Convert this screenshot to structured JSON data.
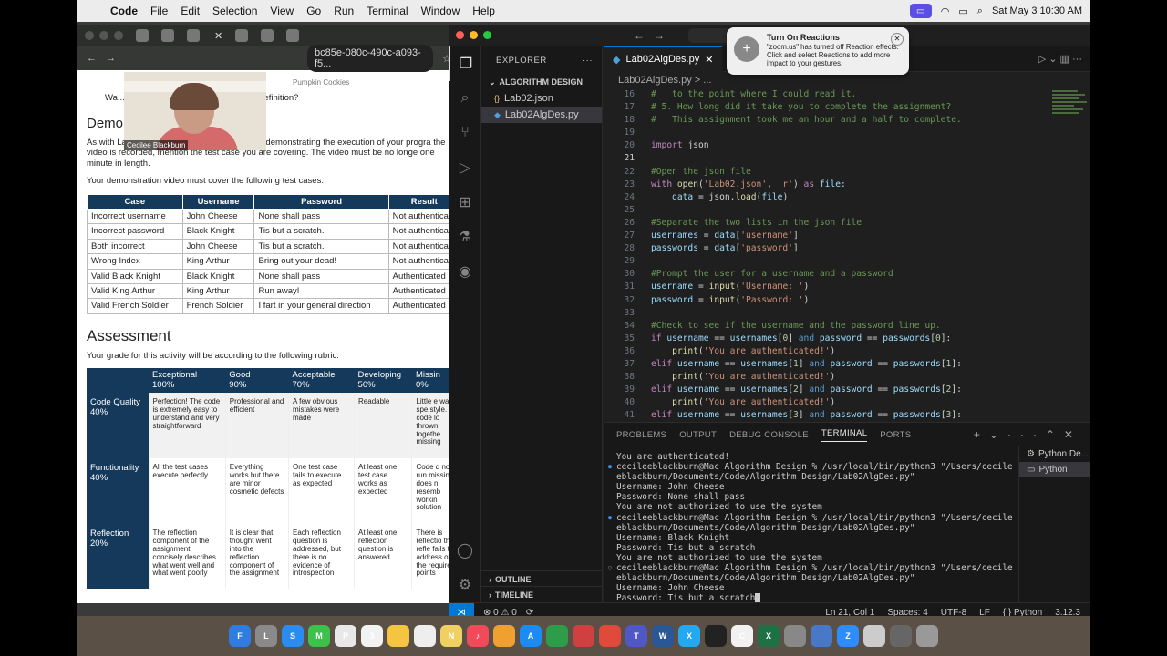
{
  "menubar": {
    "app": "Code",
    "items": [
      "File",
      "Edit",
      "Selection",
      "View",
      "Go",
      "Run",
      "Terminal",
      "Window",
      "Help"
    ],
    "datetime": "Sat May 3  10:30 AM"
  },
  "browser": {
    "address": "bc85e-080c-490c-a093-f5...",
    "tab_partial": "Pumpkin Cookies",
    "doc_line_partial": "Wa...ructions or any part of the problem definition?",
    "demo_heading": "Demon",
    "demo_para": "As with Lab 01 last week, record a short video demonstrating the execution of your progra the video is recorded, mention the test case you are covering. The video must be no longe one minute in length.",
    "demo_para2": "Your demonstration video must cover the following test cases:",
    "test_headers": [
      "Case",
      "Username",
      "Password",
      "Result"
    ],
    "test_rows": [
      [
        "Incorrect username",
        "John Cheese",
        "None shall pass",
        "Not authentica"
      ],
      [
        "Incorrect password",
        "Black Knight",
        "Tis but a scratch.",
        "Not authentica"
      ],
      [
        "Both incorrect",
        "John Cheese",
        "Tis but a scratch.",
        "Not authentica"
      ],
      [
        "Wrong Index",
        "King Arthur",
        "Bring out your dead!",
        "Not authentica"
      ],
      [
        "Valid Black Knight",
        "Black Knight",
        "None shall pass",
        "Authenticated"
      ],
      [
        "Valid King Arthur",
        "King Arthur",
        "Run away!",
        "Authenticated"
      ],
      [
        "Valid French Soldier",
        "French Soldier",
        "I fart in your general direction",
        "Authenticated"
      ]
    ],
    "assessment_heading": "Assessment",
    "assessment_para": "Your grade for this activity will be according to the following rubric:",
    "rubric_headers": [
      "",
      "Exceptional\n100%",
      "Good\n90%",
      "Acceptable\n70%",
      "Developing\n50%",
      "Missin\n0%"
    ],
    "rubric_rows": [
      [
        "Code Quality 40%",
        "Perfection! The code is extremely easy to understand and very straightforward",
        "Professional and efficient",
        "A few obvious mistakes were made",
        "Readable",
        "Little e was spe style. T code lo thrown togethe missing"
      ],
      [
        "Functionality 40%",
        "All the test cases execute perfectly",
        "Everything works but there are minor cosmetic defects",
        "One test case fails to execute as expected",
        "At least one test case works as expected",
        "Code d not run missing does n resemb workin solution"
      ],
      [
        "Reflection 20%",
        "The reflection component of the assignment concisely describes what went well and what went poorly",
        "It is clear that thought went into the reflection component of the assignment",
        "Each reflection question is addressed, but there is no evidence of introspection",
        "At least one reflection question is answered",
        "There is reflectio the refle fails to address of the required points"
      ]
    ]
  },
  "video": {
    "name": "Cecilee Blackburn"
  },
  "vscode": {
    "explorer_label": "EXPLORER",
    "folder": "ALGORITHM DESIGN",
    "files": [
      "Lab02.json",
      "Lab02AlgDes.py"
    ],
    "tab": "Lab02AlgDes.py",
    "crumb": "Lab02AlgDes.py > ...",
    "outline": "OUTLINE",
    "timeline": "TIMELINE",
    "code": [
      {
        "n": "16",
        "html": "<span class=\"cm\">#   to the point where I could read it.</span>"
      },
      {
        "n": "17",
        "html": "<span class=\"cm\"># 5. How long did it take you to complete the assignment?</span>"
      },
      {
        "n": "18",
        "html": "<span class=\"cm\">#   This assignment took me an hour and a half to complete.</span>"
      },
      {
        "n": "19",
        "html": ""
      },
      {
        "n": "20",
        "html": "<span class=\"kw\">import</span> <span class=\"tx\">json</span>"
      },
      {
        "n": "21",
        "html": ""
      },
      {
        "n": "22",
        "html": "<span class=\"cm\">#Open the json file</span>"
      },
      {
        "n": "23",
        "html": "<span class=\"kw\">with</span> <span class=\"fn\">open</span><span class=\"tx\">(</span><span class=\"st\">'Lab02.json'</span><span class=\"tx\">, </span><span class=\"st\">'r'</span><span class=\"tx\">) </span><span class=\"kw\">as</span> <span class=\"va\">file</span><span class=\"tx\">:</span>"
      },
      {
        "n": "24",
        "html": "    <span class=\"va\">data</span> <span class=\"tx\">= json.</span><span class=\"fn\">load</span><span class=\"tx\">(</span><span class=\"va\">file</span><span class=\"tx\">)</span>"
      },
      {
        "n": "25",
        "html": ""
      },
      {
        "n": "26",
        "html": "<span class=\"cm\">#Separate the two lists in the json file</span>"
      },
      {
        "n": "27",
        "html": "<span class=\"va\">usernames</span> <span class=\"tx\">= </span><span class=\"va\">data</span><span class=\"tx\">[</span><span class=\"st\">'username'</span><span class=\"tx\">]</span>"
      },
      {
        "n": "28",
        "html": "<span class=\"va\">passwords</span> <span class=\"tx\">= </span><span class=\"va\">data</span><span class=\"tx\">[</span><span class=\"st\">'password'</span><span class=\"tx\">]</span>"
      },
      {
        "n": "29",
        "html": ""
      },
      {
        "n": "30",
        "html": "<span class=\"cm\">#Prompt the user for a username and a password</span>"
      },
      {
        "n": "31",
        "html": "<span class=\"va\">username</span> <span class=\"tx\">= </span><span class=\"fn\">input</span><span class=\"tx\">(</span><span class=\"st\">'Username: '</span><span class=\"tx\">)</span>"
      },
      {
        "n": "32",
        "html": "<span class=\"va\">password</span> <span class=\"tx\">= </span><span class=\"fn\">input</span><span class=\"tx\">(</span><span class=\"st\">'Password: '</span><span class=\"tx\">)</span>"
      },
      {
        "n": "33",
        "html": ""
      },
      {
        "n": "34",
        "html": "<span class=\"cm\">#Check to see if the username and the password line up.</span>"
      },
      {
        "n": "35",
        "html": "<span class=\"kw\">if</span> <span class=\"va\">username</span> <span class=\"tx\">== </span><span class=\"va\">usernames</span><span class=\"tx\">[</span><span class=\"nm\">0</span><span class=\"tx\">] </span><span class=\"bl\">and</span> <span class=\"va\">password</span> <span class=\"tx\">== </span><span class=\"va\">passwords</span><span class=\"tx\">[</span><span class=\"nm\">0</span><span class=\"tx\">]:</span>"
      },
      {
        "n": "36",
        "html": "    <span class=\"fn\">print</span><span class=\"tx\">(</span><span class=\"st\">'You are authenticated!'</span><span class=\"tx\">)</span>"
      },
      {
        "n": "37",
        "html": "<span class=\"kw\">elif</span> <span class=\"va\">username</span> <span class=\"tx\">== </span><span class=\"va\">usernames</span><span class=\"tx\">[</span><span class=\"nm\">1</span><span class=\"tx\">] </span><span class=\"bl\">and</span> <span class=\"va\">password</span> <span class=\"tx\">== </span><span class=\"va\">passwords</span><span class=\"tx\">[</span><span class=\"nm\">1</span><span class=\"tx\">]:</span>"
      },
      {
        "n": "38",
        "html": "    <span class=\"fn\">print</span><span class=\"tx\">(</span><span class=\"st\">'You are authenticated!'</span><span class=\"tx\">)</span>"
      },
      {
        "n": "39",
        "html": "<span class=\"kw\">elif</span> <span class=\"va\">username</span> <span class=\"tx\">== </span><span class=\"va\">usernames</span><span class=\"tx\">[</span><span class=\"nm\">2</span><span class=\"tx\">] </span><span class=\"bl\">and</span> <span class=\"va\">password</span> <span class=\"tx\">== </span><span class=\"va\">passwords</span><span class=\"tx\">[</span><span class=\"nm\">2</span><span class=\"tx\">]:</span>"
      },
      {
        "n": "40",
        "html": "    <span class=\"fn\">print</span><span class=\"tx\">(</span><span class=\"st\">'You are authenticated!'</span><span class=\"tx\">)</span>"
      },
      {
        "n": "41",
        "html": "<span class=\"kw\">elif</span> <span class=\"va\">username</span> <span class=\"tx\">== </span><span class=\"va\">usernames</span><span class=\"tx\">[</span><span class=\"nm\">3</span><span class=\"tx\">] </span><span class=\"bl\">and</span> <span class=\"va\">password</span> <span class=\"tx\">== </span><span class=\"va\">passwords</span><span class=\"tx\">[</span><span class=\"nm\">3</span><span class=\"tx\">]:</span>"
      }
    ],
    "current_line": "21",
    "panel_tabs": [
      "PROBLEMS",
      "OUTPUT",
      "DEBUG CONSOLE",
      "TERMINAL",
      "PORTS"
    ],
    "terminal": [
      {
        "d": "",
        "t": "You are authenticated!"
      },
      {
        "d": "b",
        "t": "cecileeblackburn@Mac Algorithm Design % /usr/local/bin/python3 \"/Users/cecile"
      },
      {
        "d": "",
        "t": "eblackburn/Documents/Code/Algorithm Design/Lab02AlgDes.py\""
      },
      {
        "d": "",
        "t": "Username: John Cheese"
      },
      {
        "d": "",
        "t": "Password: None shall pass"
      },
      {
        "d": "",
        "t": "You are not authorized to use the system"
      },
      {
        "d": "b",
        "t": "cecileeblackburn@Mac Algorithm Design % /usr/local/bin/python3 \"/Users/cecile"
      },
      {
        "d": "",
        "t": "eblackburn/Documents/Code/Algorithm Design/Lab02AlgDes.py\""
      },
      {
        "d": "",
        "t": "Username: Black Knight"
      },
      {
        "d": "",
        "t": "Password: Tis but a scratch"
      },
      {
        "d": "",
        "t": "You are not authorized to use the system"
      },
      {
        "d": "o",
        "t": "cecileeblackburn@Mac Algorithm Design % /usr/local/bin/python3 \"/Users/cecile"
      },
      {
        "d": "",
        "t": "eblackburn/Documents/Code/Algorithm Design/Lab02AlgDes.py\""
      },
      {
        "d": "",
        "t": "Username: John Cheese"
      },
      {
        "d": "",
        "t": "Password: Tis but a scratch"
      }
    ],
    "term_list": [
      "Python De...",
      "Python"
    ],
    "status": {
      "errors": "⊗ 0 ⚠ 0",
      "position": "Ln 21, Col 1",
      "spaces": "Spaces: 4",
      "encoding": "UTF-8",
      "eol": "LF",
      "lang": "{ } Python",
      "version": "3.12.3"
    }
  },
  "reactions": {
    "title": "Turn On Reactions",
    "body": "\"zoom.us\" has turned off Reaction effects. Click and select Reactions to add more impact to your gestures."
  },
  "dock": [
    "F",
    "L",
    "S",
    "M",
    "P",
    "3",
    "",
    "",
    "N",
    "♪",
    "",
    "A",
    "",
    "",
    "",
    "T",
    "W",
    "X",
    "",
    "C",
    "X",
    "",
    "",
    "Z",
    "",
    "",
    ""
  ],
  "colors": {
    "accent": "#0078d4",
    "header_navy": "#14395b",
    "zoom": "#5b4fe3"
  }
}
